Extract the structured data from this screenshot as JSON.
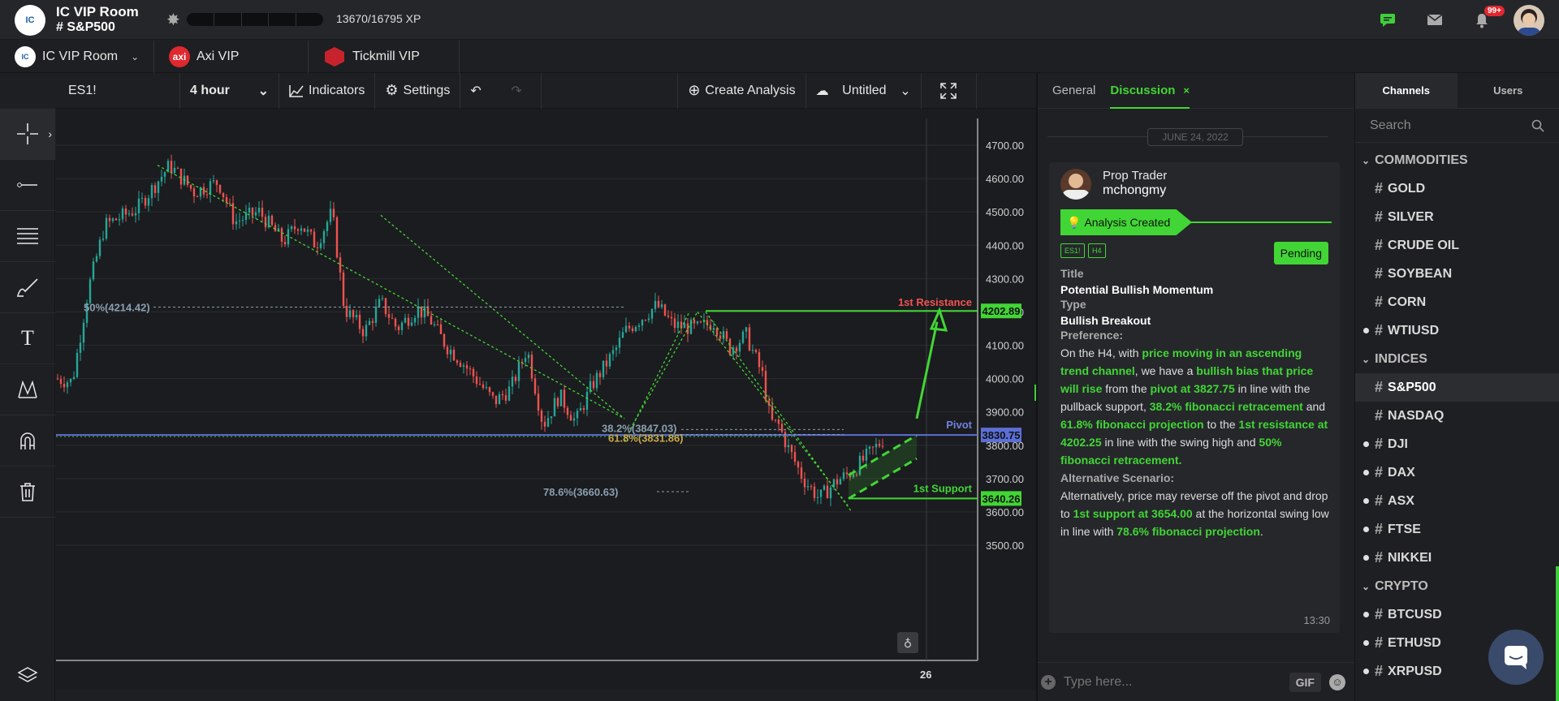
{
  "header": {
    "room_title": "IC VIP Room",
    "room_channel": "# S&P500",
    "xp": "13670/16795 XP",
    "xp_fraction": 0.814,
    "notif_count": "99+",
    "logo_text": "IC"
  },
  "room_tabs": [
    {
      "label": "IC VIP Room",
      "icon": "ic-logo-icon"
    },
    {
      "label": "Axi VIP",
      "icon": "axi-logo-icon"
    },
    {
      "label": "Tickmill VIP",
      "icon": "tickmill-logo-icon"
    }
  ],
  "toolbar": {
    "symbol": "ES1!",
    "interval": "4 hour",
    "indicators": "Indicators",
    "settings": "Settings",
    "create_analysis": "Create Analysis",
    "untitled": "Untitled"
  },
  "chart": {
    "y_ticks": [
      "4700.00",
      "4600.00",
      "4500.00",
      "4400.00",
      "4300.00",
      "4200.00",
      "4100.00",
      "4000.00",
      "3900.00",
      "3800.00",
      "3700.00",
      "3600.00",
      "3500.00"
    ],
    "x_tick": "26",
    "labels": {
      "fib50": "50%(4214.42)",
      "fib382": "38.2%(3847.03)",
      "fib618": "61.8%(3831.86)",
      "fib786": "78.6%(3660.63)",
      "resistance": "1st Resistance",
      "pivot": "Pivot",
      "support": "1st Support",
      "res_price": "4202.89",
      "pivot_price": "3830.75",
      "sup_price": "3640.26"
    }
  },
  "discussion": {
    "tab_general": "General",
    "tab_discussion": "Discussion",
    "date": "JUNE 24, 2022",
    "author_role": "Prop Trader",
    "author_name": "mchongmy",
    "banner": "Analysis Created",
    "tag1": "ES1!",
    "tag2": "H4",
    "status": "Pending",
    "title_label": "Title",
    "title_value": "Potential Bullish Momentum",
    "type_label": "Type",
    "type_value": "Bullish Breakout",
    "pref_label": "Preference:",
    "p1": "On the H4, with ",
    "g1": "price moving in an ascending trend channel",
    "p2": ", we have a ",
    "g2": "bullish bias that price will rise",
    "p3": " from the ",
    "g3": "pivot at 3827.75",
    "p4": " in line with the pullback support, ",
    "g4": "38.2% fibonacci retracement",
    "p5": " and ",
    "g5": "61.8% fibonacci projection",
    "p6": " to the ",
    "g6": "1st resistance at 4202.25",
    "p7": " in line with the swing high and ",
    "g7": "50% fibonacci retracement.",
    "alt_label": "Alternative Scenario:",
    "a1": "Alternatively, price may reverse off the pivot and drop to ",
    "ag1": "1st support at 3654.00",
    "a2": " at the horizontal swing low in line with ",
    "ag2": "78.6% fibonacci projection",
    "a3": ".",
    "time": "13:30",
    "input_placeholder": "Type here...",
    "gif": "GIF"
  },
  "channels": {
    "tab_channels": "Channels",
    "tab_users": "Users",
    "search_placeholder": "Search",
    "groups": [
      {
        "name": "COMMODITIES",
        "items": [
          {
            "label": "GOLD",
            "dot": false
          },
          {
            "label": "SILVER",
            "dot": false
          },
          {
            "label": "CRUDE OIL",
            "dot": false
          },
          {
            "label": "SOYBEAN",
            "dot": false
          },
          {
            "label": "CORN",
            "dot": false
          },
          {
            "label": "WTIUSD",
            "dot": true
          }
        ]
      },
      {
        "name": "INDICES",
        "items": [
          {
            "label": "S&P500",
            "dot": false,
            "active": true
          },
          {
            "label": "NASDAQ",
            "dot": false
          },
          {
            "label": "DJI",
            "dot": true
          },
          {
            "label": "DAX",
            "dot": true
          },
          {
            "label": "ASX",
            "dot": true
          },
          {
            "label": "FTSE",
            "dot": true
          },
          {
            "label": "NIKKEI",
            "dot": true
          }
        ]
      },
      {
        "name": "CRYPTO",
        "items": [
          {
            "label": "BTCUSD",
            "dot": true
          },
          {
            "label": "ETHUSD",
            "dot": true
          },
          {
            "label": "XRPUSD",
            "dot": true
          }
        ]
      }
    ]
  }
}
